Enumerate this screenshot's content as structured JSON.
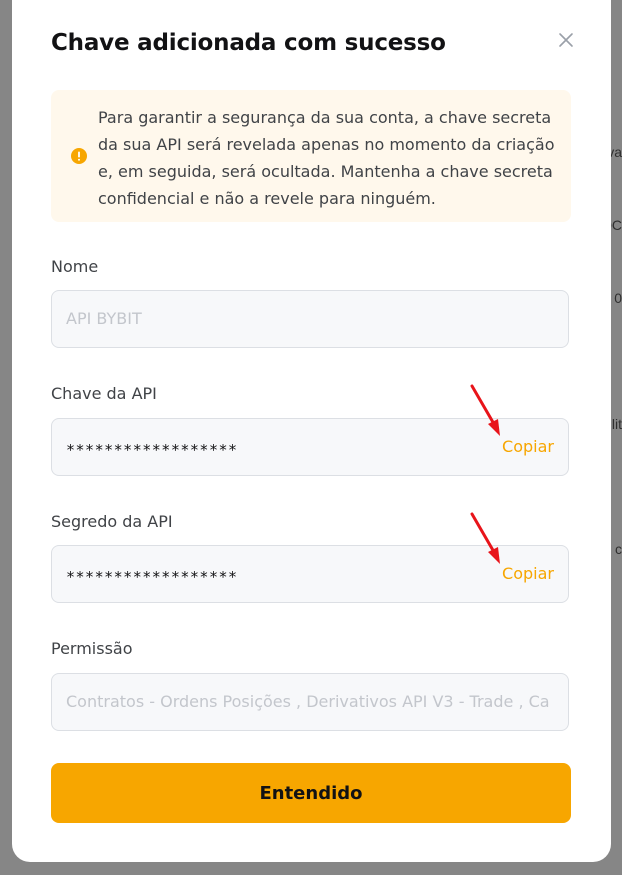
{
  "background": {
    "snippets": [
      "va",
      "0C",
      "0",
      "ilit",
      "o c"
    ]
  },
  "modal": {
    "title": "Chave adicionada com sucesso",
    "close_icon": "close-icon",
    "notice": {
      "icon": "warning-circle-icon",
      "text": "Para garantir a segurança da sua conta, a chave secreta da sua API será revelada apenas no momento da criação e, em seguida, será ocultada. Mantenha a chave secreta confidencial e não a revele para ninguém."
    },
    "name_field": {
      "label": "Nome",
      "placeholder": "API BYBIT"
    },
    "api_key_field": {
      "label": "Chave da API",
      "value": "******************",
      "copy_label": "Copiar"
    },
    "api_secret_field": {
      "label": "Segredo da API",
      "value": "******************",
      "copy_label": "Copiar"
    },
    "permission_field": {
      "label": "Permissão",
      "value": "Contratos - Ordens  Posições   , Derivativos API V3 - Trade  , Ca"
    },
    "confirm_button": "Entendido"
  },
  "colors": {
    "accent": "#f7a600",
    "annotation_arrow": "#e8141a",
    "notice_bg": "#fff8ec"
  }
}
